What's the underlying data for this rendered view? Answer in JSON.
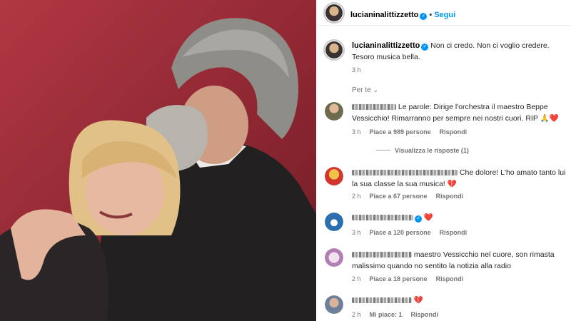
{
  "post": {
    "username": "lucianinalittizzetto",
    "follow_label": "Segui",
    "caption": "Non ci credo. Non ci voglio credere. Tesoro musica bella.",
    "caption_time": "3 h",
    "filter_label": "Per te",
    "verified_color": "#0095f6"
  },
  "comments": [
    {
      "text": "Le parole: Dirige l'orchestra il maestro Beppe Vessicchio! Rimarranno per sempre nei nostri cuori. RIP 🙏❤️",
      "time": "3 h",
      "likes": "Piace a 989 persone",
      "reply": "Rispondi",
      "view_replies": "Visualizza le risposte (1)"
    },
    {
      "text": "Che dolore! L'ho amato tanto lui la sua classe la sua musica! 💔",
      "time": "2 h",
      "likes": "Piace a 67 persone",
      "reply": "Rispondi"
    },
    {
      "text": "❤️",
      "time": "3 h",
      "likes": "Piace a 120 persone",
      "reply": "Rispondi"
    },
    {
      "text": "maestro Vessicchio nel cuore, son rimasta malissimo quando no sentito la notizia alla radio",
      "time": "2 h",
      "likes": "Piace a 18 persone",
      "reply": "Rispondi"
    },
    {
      "text": "💔",
      "time": "2 h",
      "likes": "Mi piace: 1",
      "reply": "Rispondi"
    }
  ]
}
